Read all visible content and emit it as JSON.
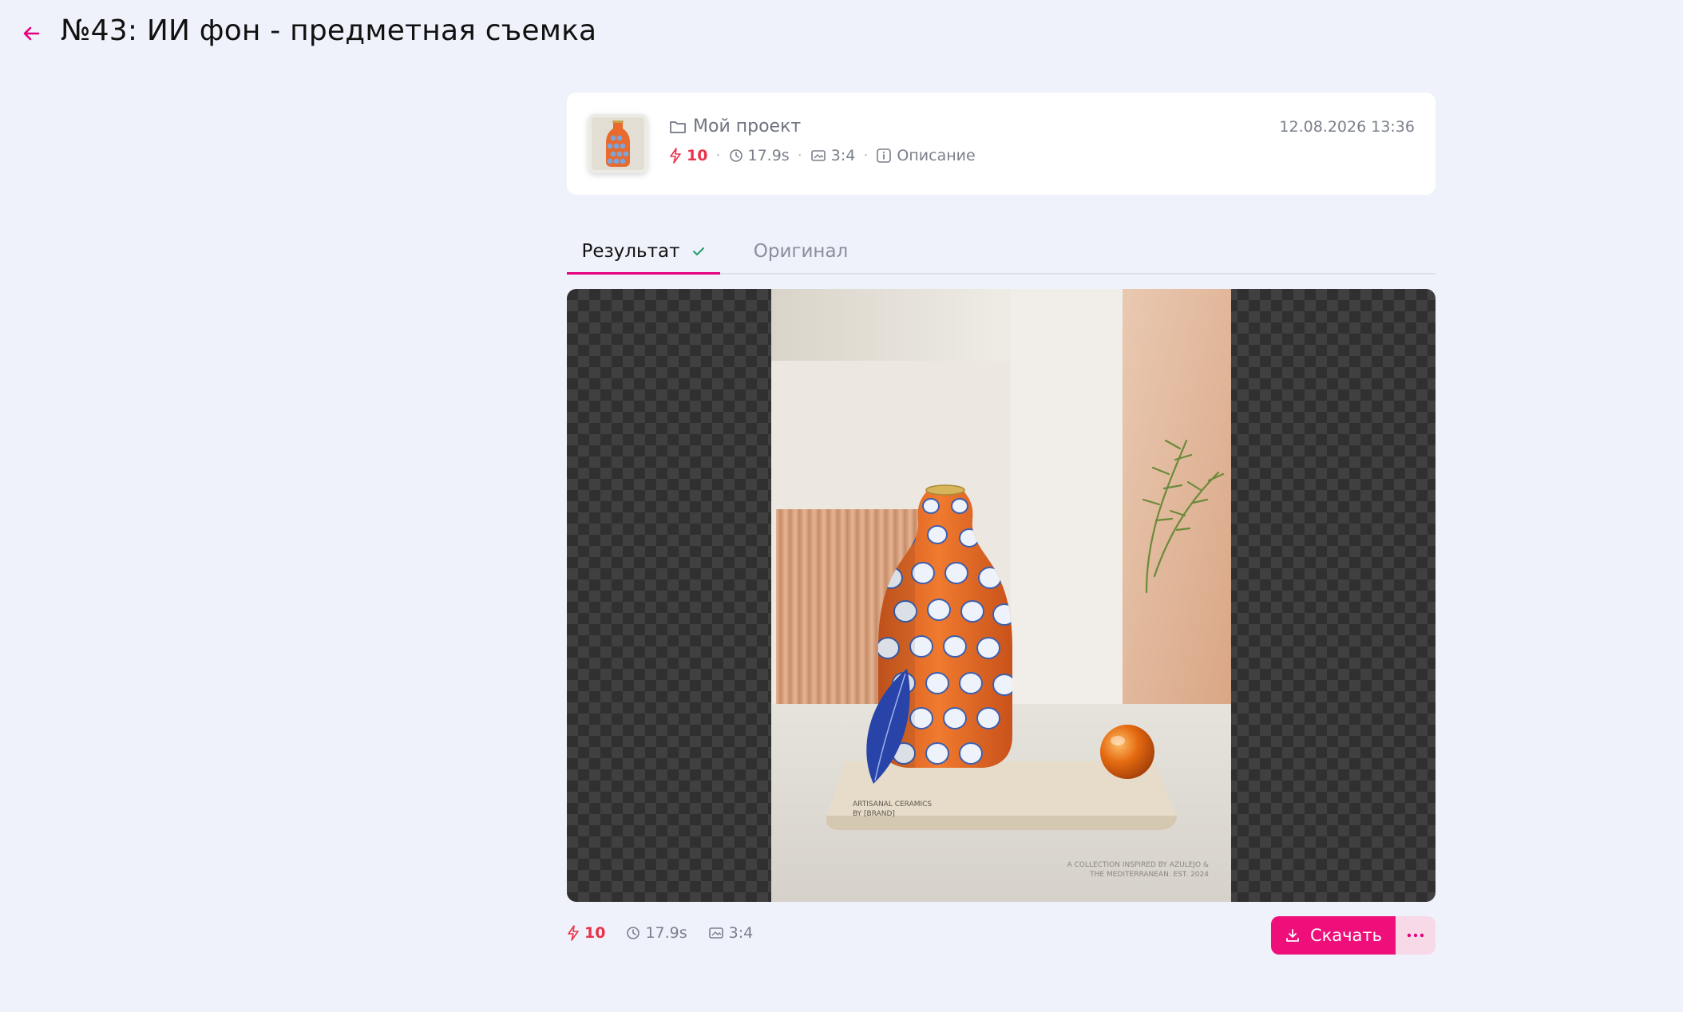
{
  "page": {
    "title": "№43: ИИ фон - предметная съемка"
  },
  "card": {
    "project": "Мой проект",
    "credits": "10",
    "duration": "17.9s",
    "ratio": "3:4",
    "description_label": "Описание",
    "date": "12.08.2026 13:36"
  },
  "tabs": [
    {
      "label": "Результат",
      "active": true
    },
    {
      "label": "Оригинал",
      "active": false
    }
  ],
  "image": {
    "label_brand_line1": "ARTISANAL CERAMICS",
    "label_brand_line2": "BY [BRAND]",
    "caption_line1": "A COLLECTION INSPIRED BY AZULEJO &",
    "caption_line2": "THE MEDITERRANEAN. EST. 2024"
  },
  "footer": {
    "credits": "10",
    "duration": "17.9s",
    "ratio": "3:4",
    "download_label": "Скачать",
    "more_label": "···"
  },
  "colors": {
    "accent": "#ee0f7b",
    "credit": "#e8334a",
    "success": "#22a06b",
    "background": "#eff2fa"
  }
}
